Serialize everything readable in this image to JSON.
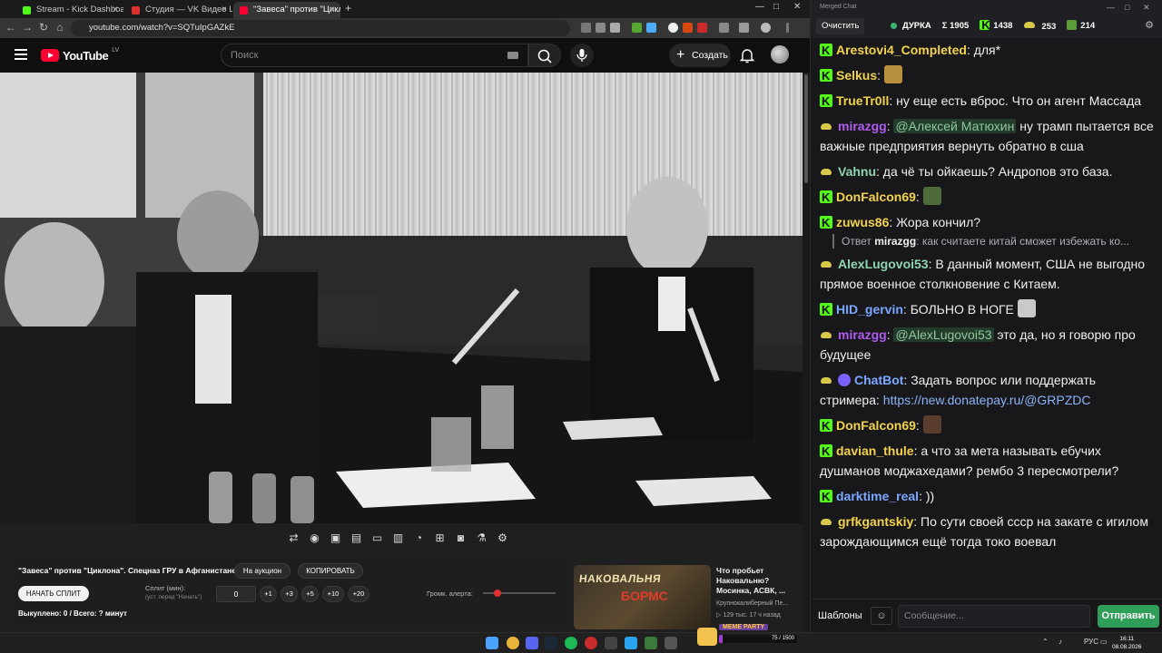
{
  "browser": {
    "tabs": [
      {
        "label": "Stream - Kick Dashboard",
        "color": "#53fc18"
      },
      {
        "label": "Студия — VK Видео Live",
        "color": "#e03131"
      },
      {
        "label": "\"Завеса\" против \"Циклона\"",
        "color": "#ff0033"
      }
    ],
    "new_tab": "+",
    "url": "youtube.com/watch?v=SQTuIpGAZkE"
  },
  "youtube": {
    "logo": "YouTube",
    "country": "LV",
    "search_placeholder": "Поиск",
    "create_label": "Создать",
    "toolbar_icons": [
      "loop-icon",
      "broadcast-icon",
      "cast-icon",
      "clapperboard-icon",
      "pip-icon",
      "subtitles-icon",
      "speed-icon",
      "add-icon",
      "screenshot-icon",
      "flask-icon",
      "gear-icon"
    ],
    "recommendation": {
      "thumb_text_1": "НАКОВАЛЬНЯ",
      "thumb_text_2": "БОРМС",
      "title": "Что пробьет Наковальню? Мосинка, АСВК, ...",
      "channel": "Крупнокалиберный Пе...",
      "meta": "▷ 129 тыс.  17 ч назад"
    }
  },
  "extension": {
    "title": "\"Завеса\" против \"Циклона\". Спецназ ГРУ в Афганистане.",
    "auction_label": "На аукцион",
    "copy_label": "КОПИРОВАТЬ",
    "start_split_label": "НАЧАТЬ СПЛИТ",
    "split_label": "Сплит (мин):",
    "split_hint": "(уст. перед \"Начать\")",
    "split_value": "0",
    "increments": [
      "+1",
      "+3",
      "+5",
      "+10",
      "+20"
    ],
    "volume_label": "Громк. алерта:",
    "volume_level": 0.2,
    "status": "Выкуплено: 0 / Всего: ? минут"
  },
  "chat": {
    "window_title": "Merged Chat",
    "clear_label": "Очистить",
    "stream_name": "ДУРКА",
    "stats": [
      {
        "icon": "Σ",
        "value": "1905"
      },
      {
        "icon": "K",
        "value": "1438"
      },
      {
        "icon": "vk",
        "value": "253"
      },
      {
        "icon": "rumble",
        "value": "214"
      }
    ],
    "messages": [
      {
        "platform": "kick",
        "user": "Arestovi4_Completed",
        "color": "#f2d34b",
        "text": "для*"
      },
      {
        "platform": "kick",
        "user": "Selkus",
        "color": "#f2d34b",
        "emote": "#b8903d",
        "text": ""
      },
      {
        "platform": "kick",
        "user": "TrueTr0ll",
        "color": "#f2d34b",
        "text": "ну еще есть вброс. Что он агент Массада"
      },
      {
        "platform": "vk",
        "user": "mirazgg",
        "color": "#b05cf0",
        "mention": "@Алексей Матюхин",
        "text": "ну трамп пытается все важные предприятия вернуть обратно в сша"
      },
      {
        "platform": "vk",
        "user": "Vahnu",
        "color": "#8fd6b0",
        "text": "да чё ты ойкаешь? Андропов это база."
      },
      {
        "platform": "kick",
        "user": "DonFalcon69",
        "color": "#f2d34b",
        "emote": "#4d6b3b",
        "text": ""
      },
      {
        "platform": "kick",
        "user": "zuwus86",
        "color": "#f2d34b",
        "text": "Жора кончил?"
      },
      {
        "reply": true,
        "reply_prefix": "Ответ",
        "reply_user": "mirazgg",
        "reply_text": "как считаете китай сможет избежать ко..."
      },
      {
        "platform": "vk",
        "user": "AlexLugovoi53",
        "color": "#8fd6b0",
        "text": "В данный момент, США не выгодно прямое военное столкновение с Китаем."
      },
      {
        "platform": "kick",
        "user": "HID_gervin",
        "color": "#7aa7ff",
        "text": "БОЛЬНО В НОГЕ",
        "emote_after": "#c9c9c9"
      },
      {
        "platform": "vk",
        "user": "mirazgg",
        "color": "#b05cf0",
        "mention": "@AlexLugovoi53",
        "text": "это да, но я говорю про будущее"
      },
      {
        "platform": "vk",
        "user": "ChatBot",
        "color": "#7aa7ff",
        "bot": true,
        "text": "Задать вопрос или поддержать стримера:",
        "link": "https://new.donatepay.ru/@GRPZDC"
      },
      {
        "platform": "kick",
        "user": "DonFalcon69",
        "color": "#f2d34b",
        "emote": "#5a3d2e",
        "text": ""
      },
      {
        "platform": "kick",
        "user": "davian_thule",
        "color": "#f2d34b",
        "text": "а что за мета называть ебучих душманов моджахедами? рембо 3 пересмотрели?"
      },
      {
        "platform": "kick",
        "user": "darktime_real",
        "color": "#7aa7ff",
        "text": "))"
      },
      {
        "platform": "vk",
        "user": "grfkgantskiy",
        "color": "#f2d34b",
        "text": "По сути своей ссср на закате с игилом зарождающимся ещё тогда токо воевал"
      }
    ],
    "templates_label": "Шаблоны",
    "emoji_label": "☺",
    "input_placeholder": "Сообщение...",
    "send_label": "Отправить"
  },
  "taskbar": {
    "widget_label": "MEME PARTY",
    "widget_progress_text": "75 / 1500",
    "widget_progress": 0.05,
    "lang": "РУС",
    "time": "16:11",
    "date": "08.08.2026"
  }
}
